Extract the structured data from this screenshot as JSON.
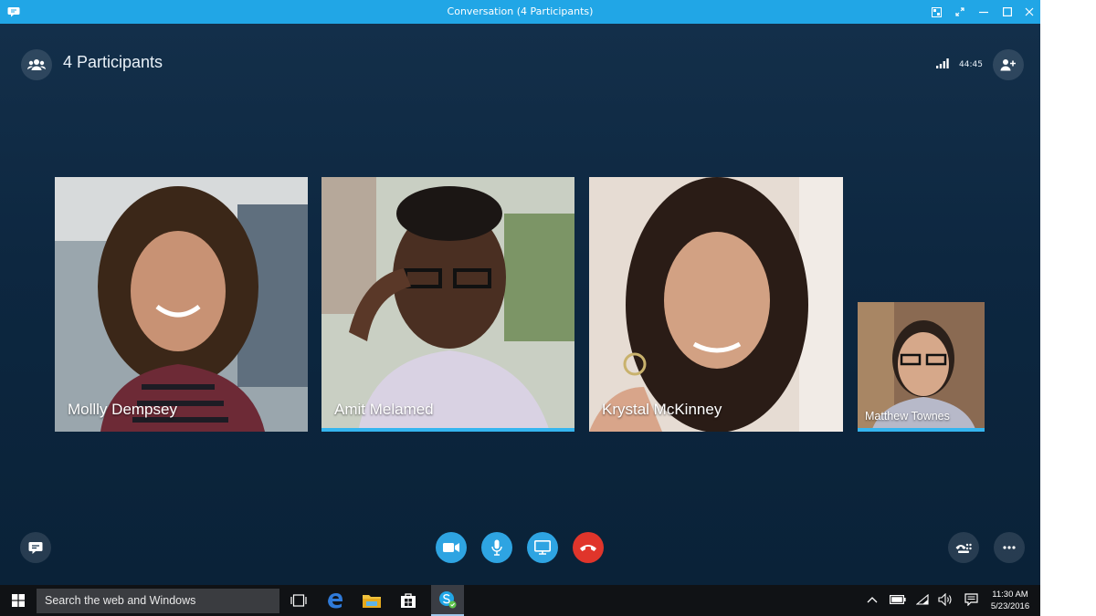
{
  "window": {
    "title": "Conversation (4 Participants)"
  },
  "header": {
    "participants_label": "4 Participants",
    "call_duration": "44:45"
  },
  "participants": [
    {
      "name": "Mollly Dempsey",
      "speaking": false
    },
    {
      "name": "Amit Melamed",
      "speaking": true
    },
    {
      "name": "Krystal McKinney",
      "speaking": false
    },
    {
      "name": "Matthew Townes",
      "speaking": true
    }
  ],
  "controls": {
    "icons": [
      "chat-icon",
      "video-icon",
      "microphone-icon",
      "screen-share-icon",
      "hang-up-icon",
      "dialpad-icon",
      "more-options-icon"
    ],
    "accent": "#2ea4e2",
    "hangup_color": "#e0352b"
  },
  "taskbar": {
    "search_placeholder": "Search the web and Windows",
    "time": "11:30 AM",
    "date": "5/23/2016"
  },
  "colors": {
    "titlebar": "#21a6e6",
    "background": "#0d2740",
    "speaking_indicator": "#35b5ef"
  }
}
